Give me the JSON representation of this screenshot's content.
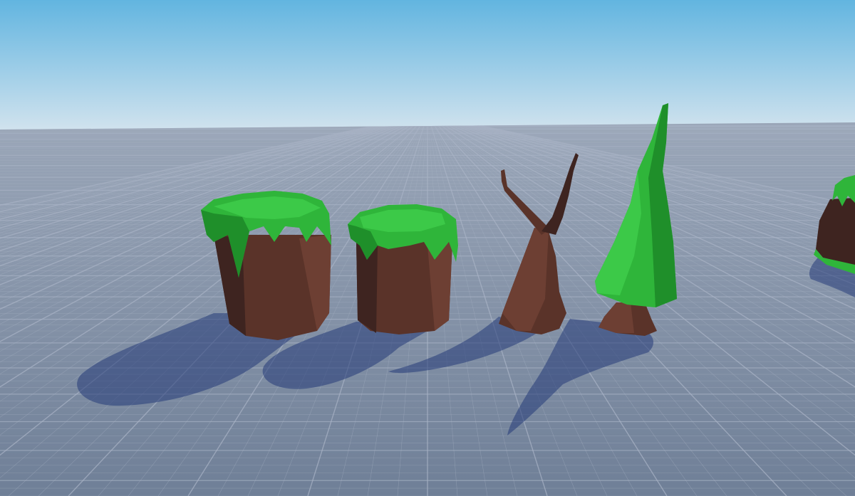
{
  "scene": {
    "sky_top_color": "#62b5e0",
    "sky_horizon_color": "#d2e3ee",
    "ground_far_color": "#9aa6b8",
    "ground_near_color": "#6f7f97",
    "grid_line_color": "#a9b4c6",
    "shadow_color": "#243a78",
    "grass_color": "#2fb53a",
    "grass_dark_color": "#1f8f2a",
    "bark_color": "#5a3329",
    "bark_dark_color": "#3e2420",
    "bark_light_color": "#6d3f33",
    "objects": [
      {
        "name": "tall-grass-stump"
      },
      {
        "name": "short-grass-stump"
      },
      {
        "name": "forked-dead-tree"
      },
      {
        "name": "low-poly-pine-tree"
      },
      {
        "name": "partial-grass-stump"
      }
    ]
  }
}
